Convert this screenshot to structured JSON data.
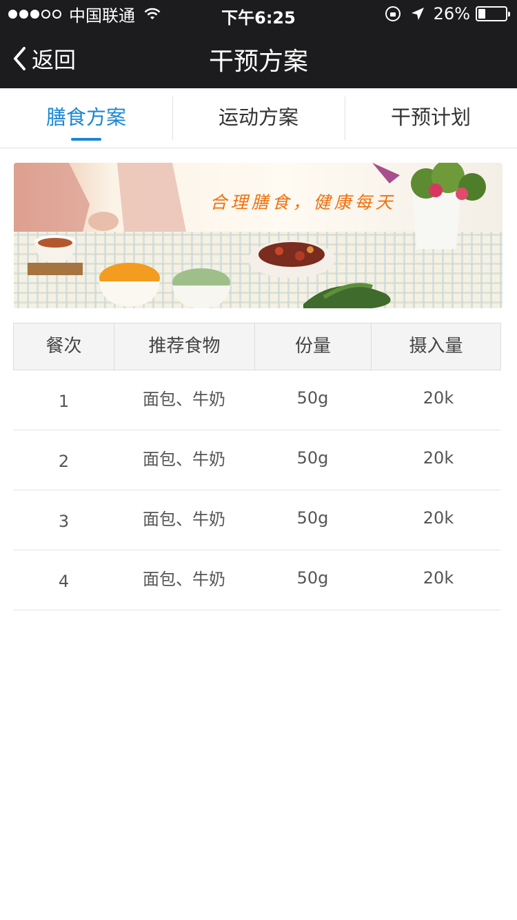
{
  "status_bar": {
    "carrier": "中国联通",
    "time": "下午6:25",
    "battery_percent": "26%",
    "battery_level": 0.26,
    "signal_bars": 3,
    "signal_total": 5,
    "icons": [
      "signal-dots-icon",
      "wifi-icon",
      "orientation-lock-icon",
      "location-arrow-icon",
      "battery-icon"
    ]
  },
  "nav": {
    "back_label": "返回",
    "title": "干预方案",
    "back_icon": "chevron-left-icon"
  },
  "tabs": [
    {
      "label": "膳食方案",
      "active": true
    },
    {
      "label": "运动方案",
      "active": false
    },
    {
      "label": "干预计划",
      "active": false
    }
  ],
  "banner": {
    "slogan": "合理膳食，健康每天"
  },
  "table": {
    "headers": [
      "餐次",
      "推荐食物",
      "份量",
      "摄入量"
    ],
    "rows": [
      {
        "meal": "1",
        "food": "面包、牛奶",
        "portion": "50g",
        "intake": "20k"
      },
      {
        "meal": "2",
        "food": "面包、牛奶",
        "portion": "50g",
        "intake": "20k"
      },
      {
        "meal": "3",
        "food": "面包、牛奶",
        "portion": "50g",
        "intake": "20k"
      },
      {
        "meal": "4",
        "food": "面包、牛奶",
        "portion": "50g",
        "intake": "20k"
      }
    ]
  },
  "colors": {
    "header_bg": "#1c1c1e",
    "accent": "#1a86d4",
    "slogan": "#f0710f"
  }
}
